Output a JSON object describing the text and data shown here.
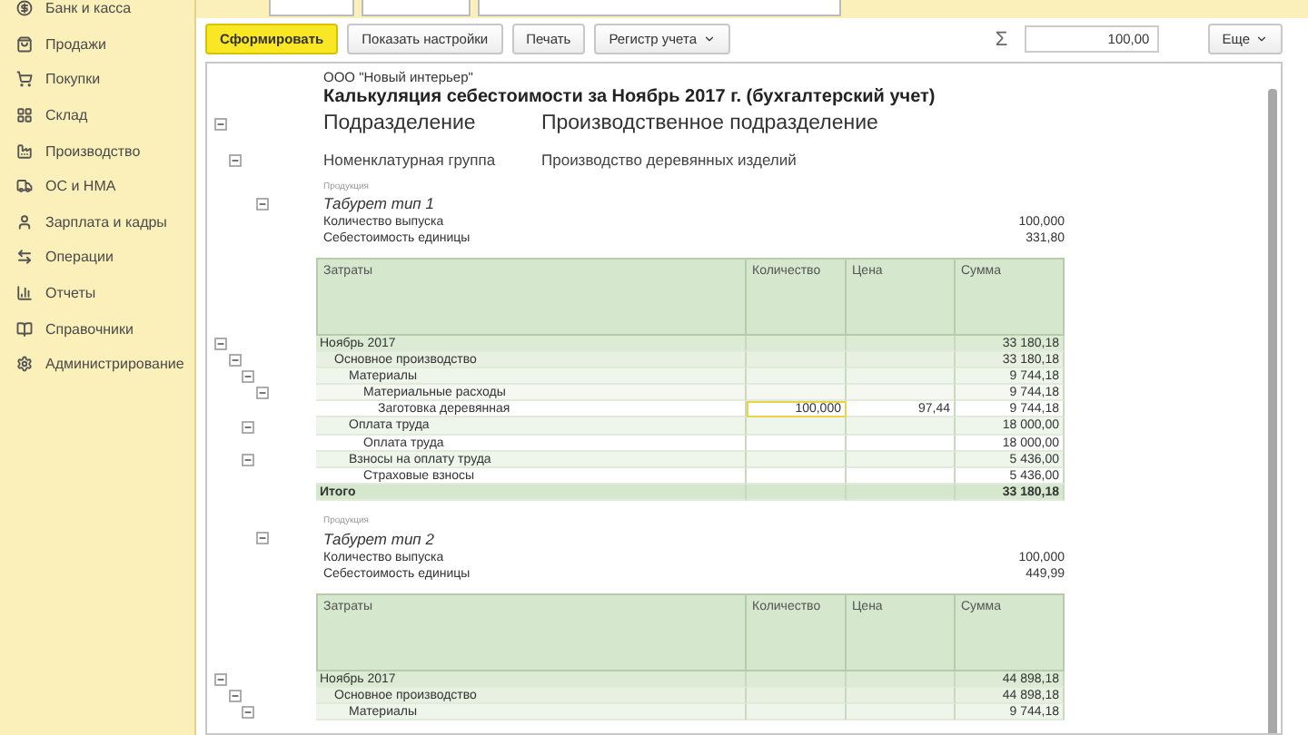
{
  "sidebar": {
    "items": [
      {
        "label": "Банк и касса"
      },
      {
        "label": "Продажи"
      },
      {
        "label": "Покупки"
      },
      {
        "label": "Склад"
      },
      {
        "label": "Производство"
      },
      {
        "label": "ОС и НМА"
      },
      {
        "label": "Зарплата и кадры"
      },
      {
        "label": "Операции"
      },
      {
        "label": "Отчеты"
      },
      {
        "label": "Справочники"
      },
      {
        "label": "Администрирование"
      }
    ]
  },
  "toolbar": {
    "buttons": [
      {
        "label": "Сформировать",
        "kind": "primary"
      },
      {
        "label": "Показать настройки",
        "kind": "plain"
      },
      {
        "label": "Печать",
        "kind": "plain"
      },
      {
        "label": "Регистр учета",
        "kind": "dropdown"
      }
    ],
    "sum_sign": "Σ",
    "sum_value": "100,00",
    "more": "Еще"
  },
  "report": {
    "organization": "ООО \"Новый интерьер\"",
    "title": "Калькуляция себестоимости за Ноябрь 2017 г. (бухгалтерский учет)",
    "expanded": true,
    "department_label": "Подразделение",
    "department": "Производственное подразделение",
    "group_label": "Номенклатурная группа",
    "group": "Производство деревянных изделий",
    "products": [
      {
        "caption": "Продукция",
        "name": "Табурет тип 1",
        "expanded": true,
        "stats": [
          {
            "label": "Количество выпуска",
            "value": "100,000"
          },
          {
            "label": "Себестоимость единицы",
            "value": "331,80"
          }
        ],
        "columns": [
          "Затраты",
          "Количество",
          "Цена",
          "Сумма"
        ],
        "rows": [
          {
            "label": "Ноябрь 2017",
            "sum": "33 180,18",
            "selected": false,
            "expanded": true,
            "children": [
              {
                "label": "Основное производство",
                "sum": "33 180,18",
                "selected": false,
                "expanded": true,
                "children": [
                  {
                    "label": "Материалы",
                    "sum": "9 744,18",
                    "selected": false,
                    "expanded": true,
                    "children": [
                      {
                        "label": "Материальные расходы",
                        "sum": "9 744,18",
                        "selected": false,
                        "expanded": true,
                        "children": [
                          {
                            "label": "Заготовка деревянная",
                            "quantity": "100,000",
                            "price": "97,44",
                            "sum": "9 744,18",
                            "selected": true
                          }
                        ]
                      }
                    ]
                  },
                  {
                    "label": "Оплата труда",
                    "sum": "18 000,00",
                    "selected": false,
                    "expanded": true,
                    "children": [
                      {
                        "label": "Оплата труда",
                        "sum": "18 000,00",
                        "selected": false
                      }
                    ]
                  },
                  {
                    "label": "Взносы на оплату труда",
                    "sum": "5 436,00",
                    "selected": false,
                    "expanded": true,
                    "children": [
                      {
                        "label": "Страховые взносы",
                        "sum": "5 436,00",
                        "selected": false
                      }
                    ]
                  }
                ]
              }
            ]
          }
        ],
        "total": {
          "label": "Итого",
          "sum": "33 180,18"
        }
      },
      {
        "caption": "Продукция",
        "name": "Табурет тип 2",
        "expanded": true,
        "stats": [
          {
            "label": "Количество выпуска",
            "value": "100,000"
          },
          {
            "label": "Себестоимость единицы",
            "value": "449,99"
          }
        ],
        "columns": [
          "Затраты",
          "Количество",
          "Цена",
          "Сумма"
        ],
        "rows": [
          {
            "label": "Ноябрь 2017",
            "sum": "44 898,18",
            "selected": false,
            "expanded": true,
            "children": [
              {
                "label": "Основное производство",
                "sum": "44 898,18",
                "selected": false,
                "expanded": true,
                "children": [
                  {
                    "label": "Материалы",
                    "sum": "9 744,18",
                    "selected": false,
                    "expanded": true
                  }
                ]
              }
            ]
          }
        ]
      }
    ]
  }
}
